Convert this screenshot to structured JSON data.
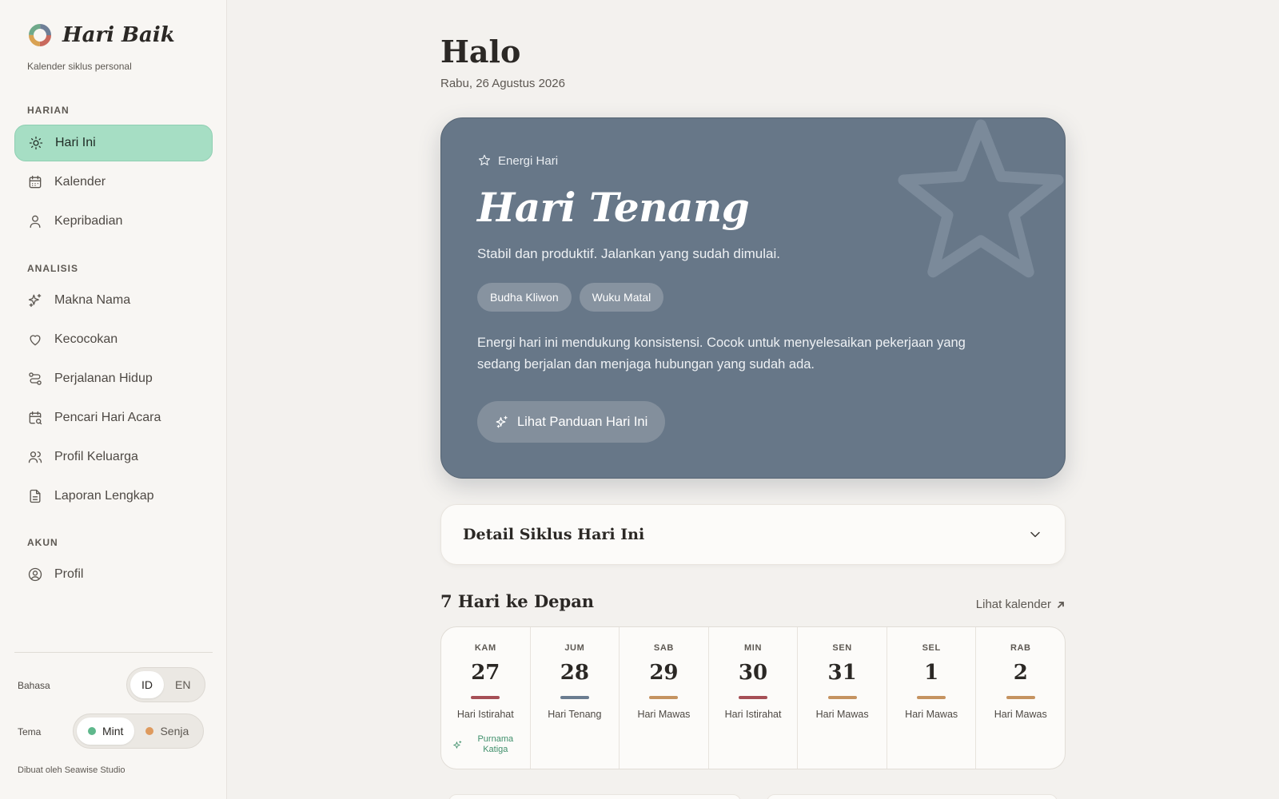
{
  "brand": {
    "name": "Hari Baik",
    "subtitle": "Kalender siklus personal"
  },
  "sidebar": {
    "sections": [
      {
        "title": "HARIAN",
        "items": [
          {
            "label": "Hari Ini",
            "icon": "sun-icon",
            "active": true
          },
          {
            "label": "Kalender",
            "icon": "calendar-icon"
          },
          {
            "label": "Kepribadian",
            "icon": "user-icon"
          }
        ]
      },
      {
        "title": "ANALISIS",
        "items": [
          {
            "label": "Makna Nama",
            "icon": "sparkles-icon"
          },
          {
            "label": "Kecocokan",
            "icon": "heart-icon"
          },
          {
            "label": "Perjalanan Hidup",
            "icon": "route-icon"
          },
          {
            "label": "Pencari Hari Acara",
            "icon": "calendar-search-icon"
          },
          {
            "label": "Profil Keluarga",
            "icon": "users-icon"
          },
          {
            "label": "Laporan Lengkap",
            "icon": "document-icon"
          }
        ]
      },
      {
        "title": "AKUN",
        "items": [
          {
            "label": "Profil",
            "icon": "user-circle-icon"
          }
        ]
      }
    ],
    "language": {
      "label": "Bahasa",
      "options": [
        "ID",
        "EN"
      ],
      "selected": "ID"
    },
    "theme": {
      "label": "Tema",
      "options": [
        "Mint",
        "Senja"
      ],
      "selected": "Mint",
      "colors": {
        "Mint": "#5fb88c",
        "Senja": "#de9a5e"
      }
    },
    "credit": "Dibuat oleh Seawise Studio"
  },
  "header": {
    "greeting": "Halo",
    "date": "Rabu, 26 Agustus 2026"
  },
  "energy": {
    "eyebrow": "Energi Hari",
    "title": "Hari Tenang",
    "subtitle": "Stabil dan produktif. Jalankan yang sudah dimulai.",
    "chips": [
      "Budha Kliwon",
      "Wuku Matal"
    ],
    "description": "Energi hari ini mendukung konsistensi. Cocok untuk menyelesaikan pekerjaan yang sedang berjalan dan menjaga hubungan yang sudah ada.",
    "button": "Lihat Panduan Hari Ini",
    "card_color": "#677788"
  },
  "detail": {
    "title": "Detail Siklus Hari Ini"
  },
  "week": {
    "title": "7 Hari ke Depan",
    "link": "Lihat kalender",
    "days": [
      {
        "name": "KAM",
        "num": "27",
        "label": "Hari Istirahat",
        "color": "#a64f56",
        "event": "Purnama Katiga"
      },
      {
        "name": "JUM",
        "num": "28",
        "label": "Hari Tenang",
        "color": "#6a7c90"
      },
      {
        "name": "SAB",
        "num": "29",
        "label": "Hari Mawas",
        "color": "#c59360"
      },
      {
        "name": "MIN",
        "num": "30",
        "label": "Hari Istirahat",
        "color": "#a64f56"
      },
      {
        "name": "SEN",
        "num": "31",
        "label": "Hari Mawas",
        "color": "#c59360"
      },
      {
        "name": "SEL",
        "num": "1",
        "label": "Hari Mawas",
        "color": "#c59360"
      },
      {
        "name": "RAB",
        "num": "2",
        "label": "Hari Mawas",
        "color": "#c59360"
      }
    ]
  }
}
